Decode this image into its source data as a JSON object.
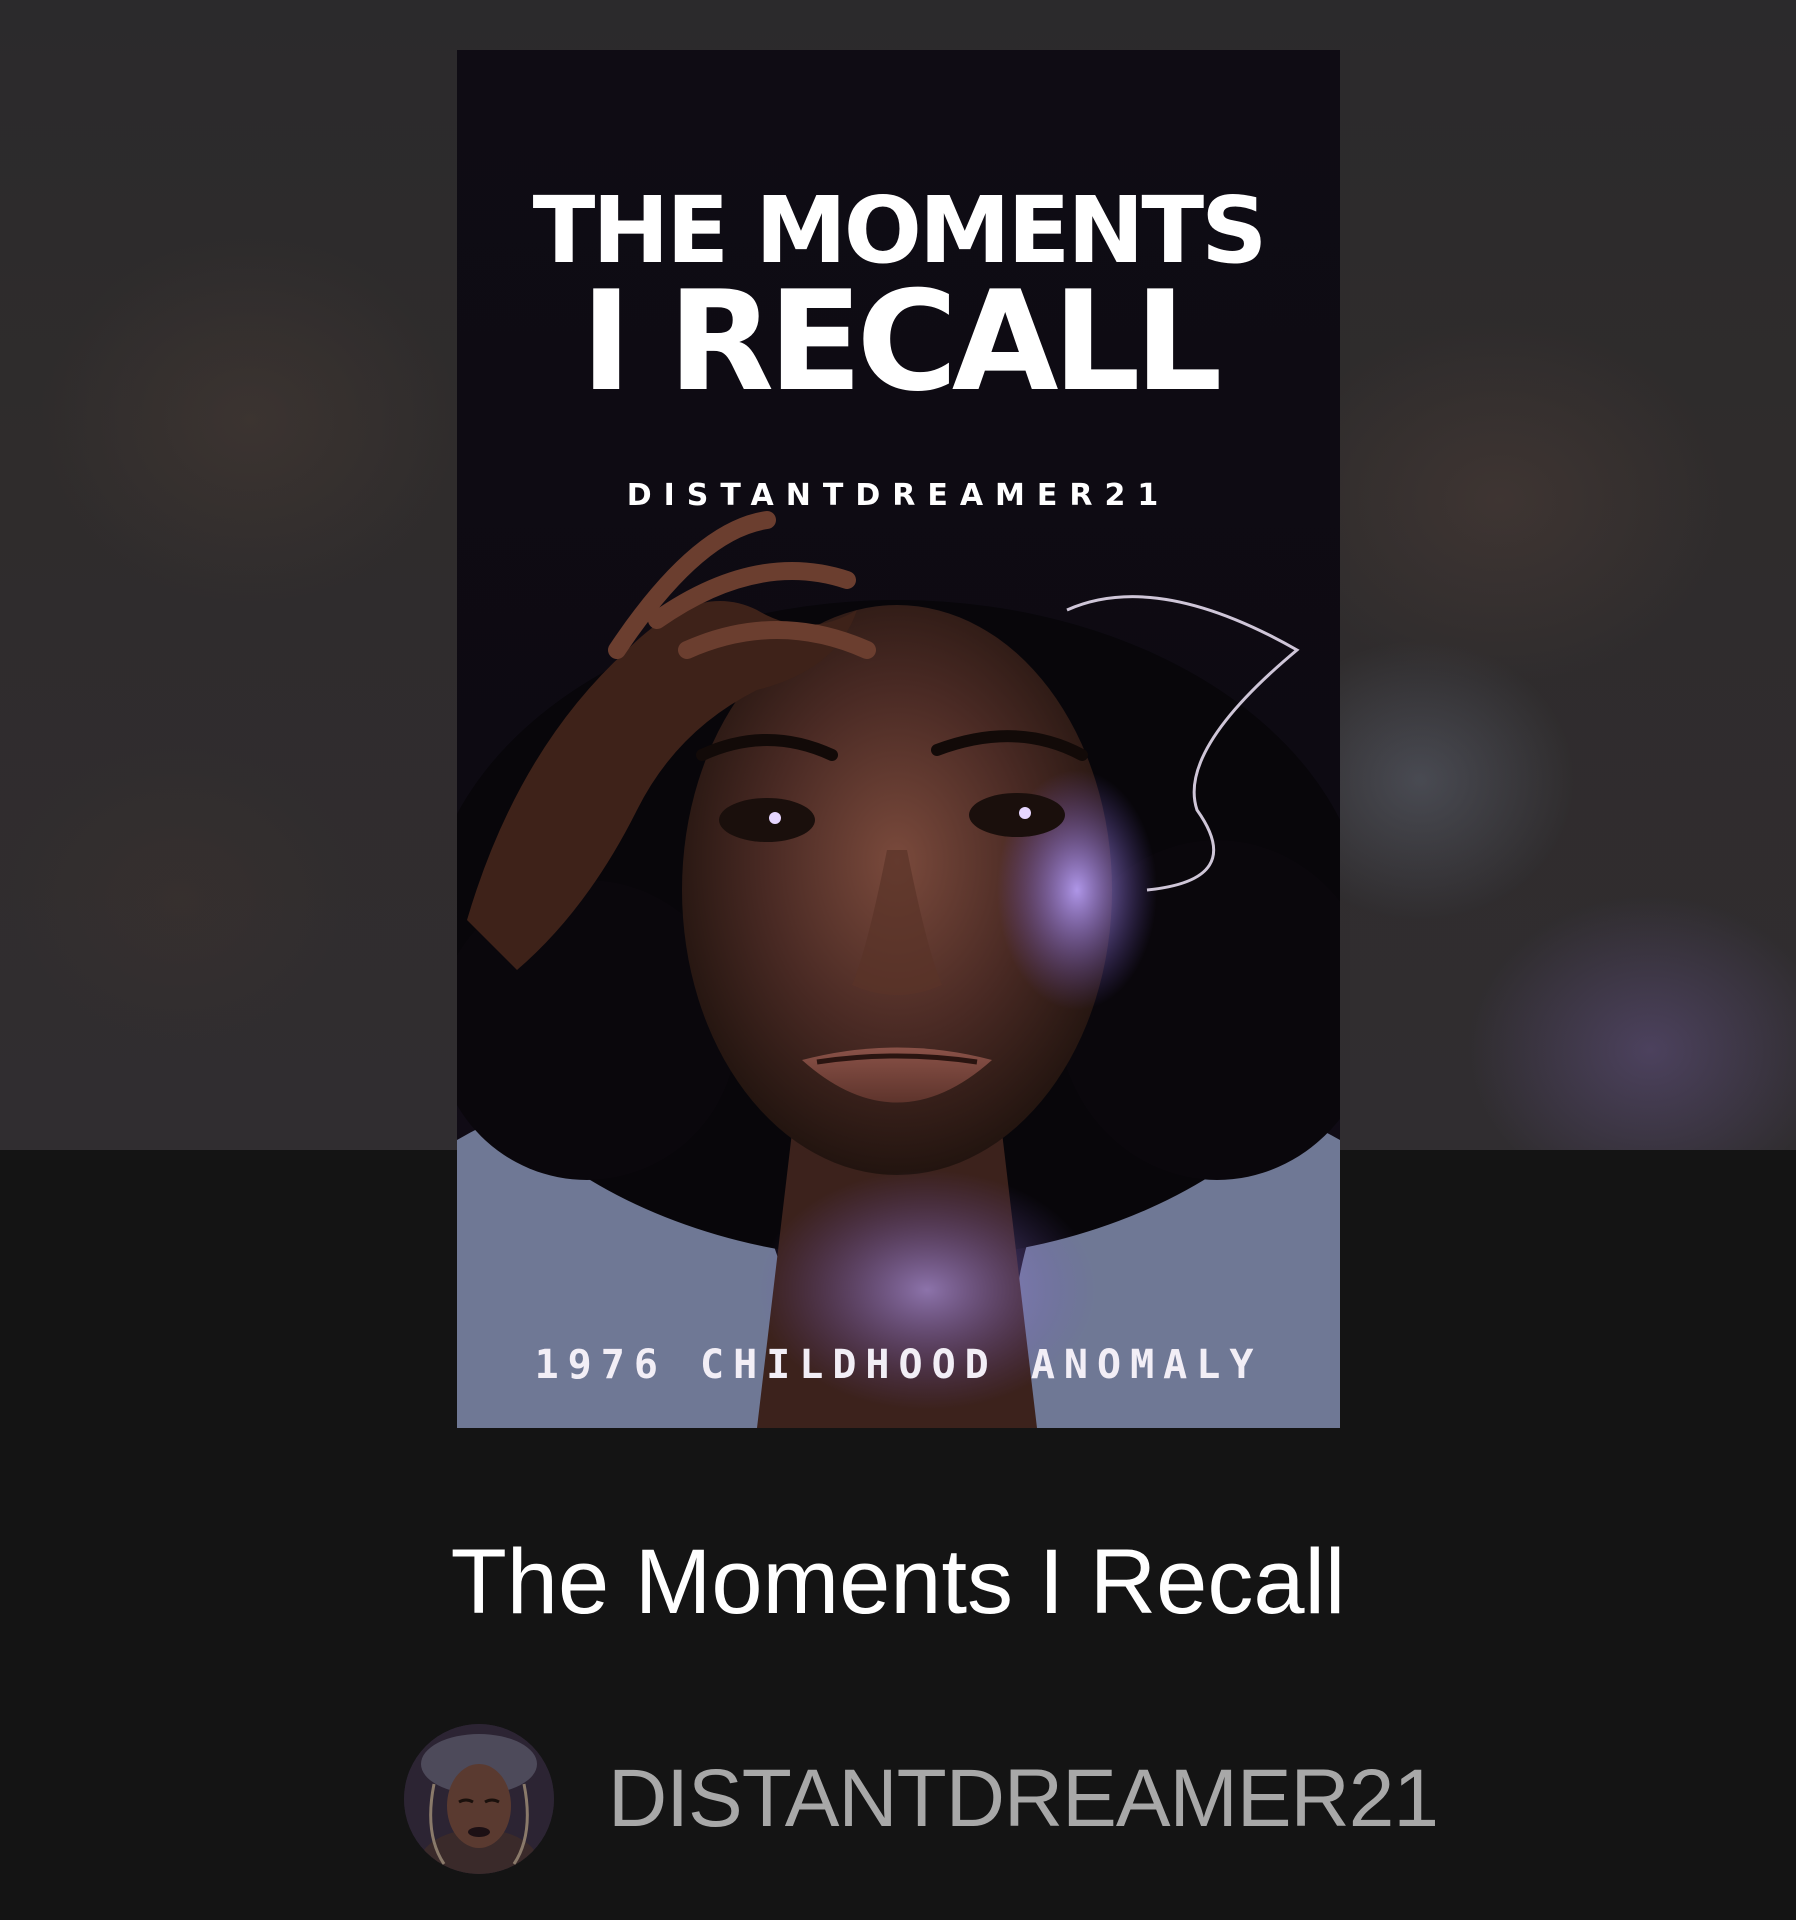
{
  "cover": {
    "title_line1": "THE MOMENTS",
    "title_line2": "I RECALL",
    "author": "DISTANTDREAMER21",
    "tagline": "1976 CHILDHOOD ANOMALY"
  },
  "story": {
    "title": "The Moments I Recall"
  },
  "author": {
    "name": "DISTANTDREAMER21"
  },
  "colors": {
    "page_background": "#141414",
    "title_text": "#ffffff",
    "author_text": "#a8a8a8"
  }
}
